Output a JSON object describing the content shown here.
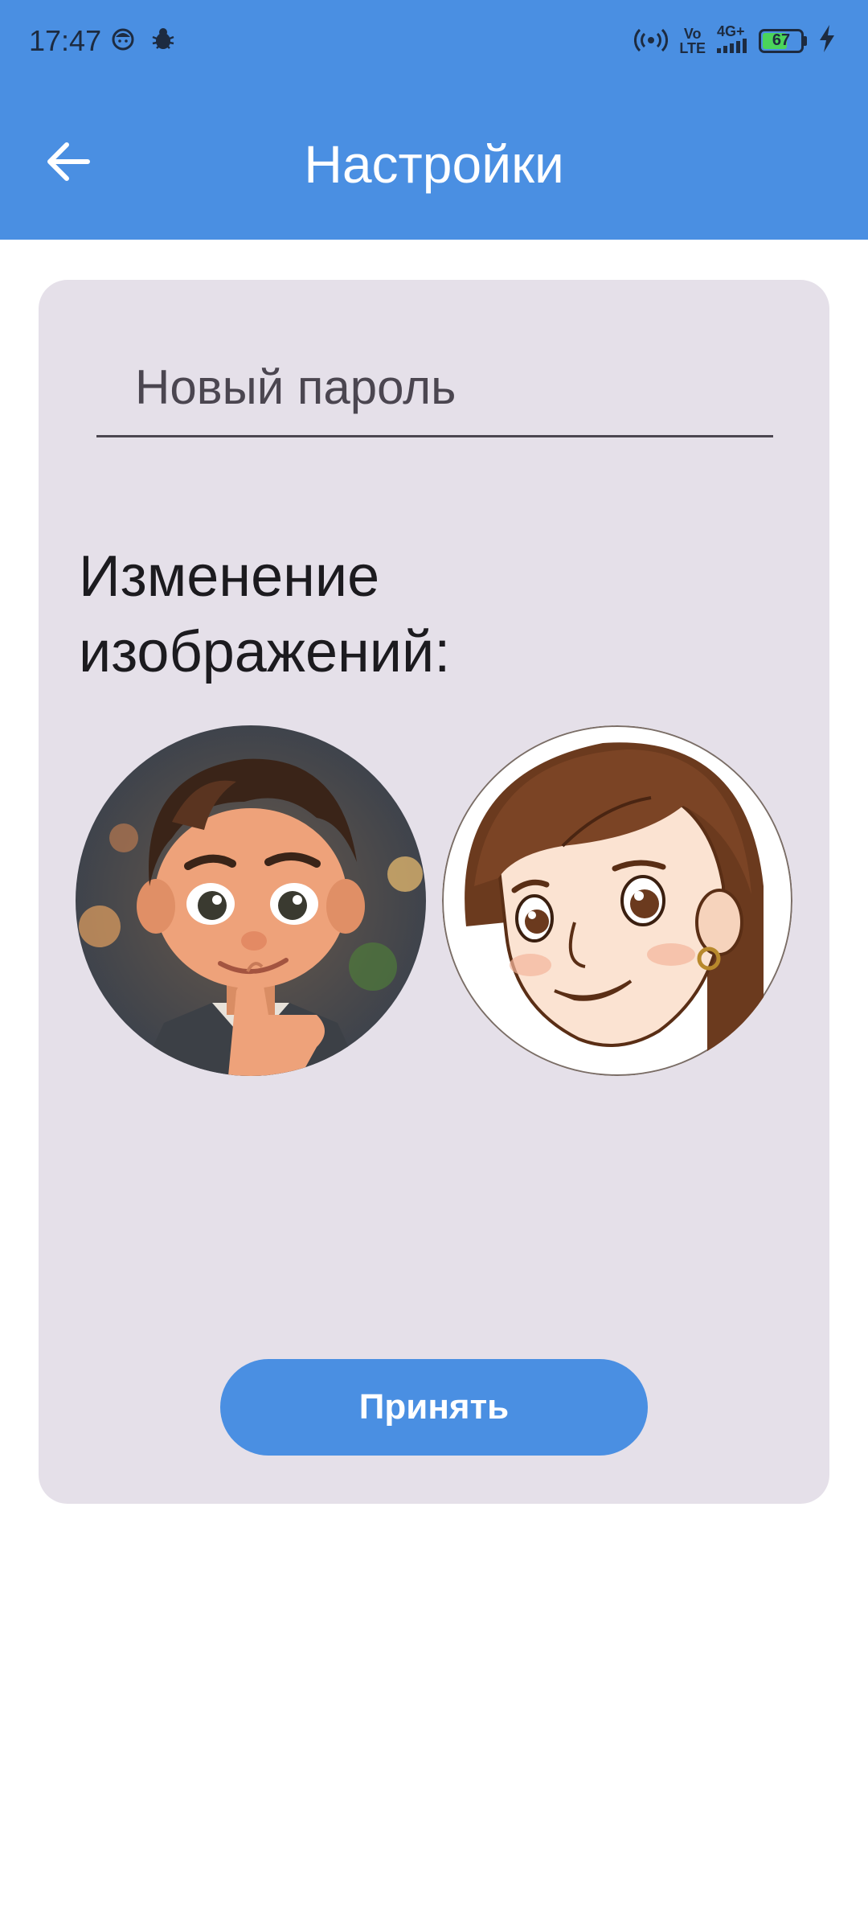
{
  "status_bar": {
    "time": "17:47",
    "network_volte_top": "Vo",
    "network_volte_bottom": "LTE",
    "network_type": "4G+",
    "battery_percent": "67",
    "battery_level": 0.67,
    "icons": [
      "face-icon",
      "bug-icon",
      "hotspot-icon",
      "signal-icon",
      "battery-icon",
      "charging-icon"
    ]
  },
  "app_bar": {
    "title": "Настройки",
    "background": "#4a8fe2",
    "back_icon": "arrow-back-icon"
  },
  "form": {
    "password_placeholder": "Новый пароль",
    "password_value": "",
    "images_heading": "Изменение изображений:",
    "avatars": [
      "boy-avatar",
      "girl-avatar"
    ],
    "accept_label": "Принять"
  }
}
